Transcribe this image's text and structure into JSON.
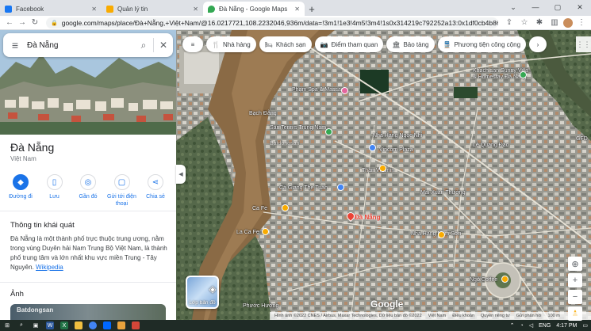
{
  "browser": {
    "tabs": [
      {
        "title": "Facebook",
        "color": "#1877f2",
        "active": false
      },
      {
        "title": "Quản lý tin",
        "color": "#f9ab00",
        "active": false
      },
      {
        "title": "Đà Nẵng - Google Maps",
        "color": "#34a853",
        "active": true
      }
    ],
    "new_tab": "+",
    "url": "google.com/maps/place/Đà+Nẵng,+Việt+Nam/@16.0217721,108.2232046,936m/data=!3m1!1e3!4m5!3m4!1s0x314219c792252a13:0x1df0cb4b86727e..."
  },
  "search": {
    "query": "Đà Nẵng"
  },
  "place": {
    "name": "Đà Nẵng",
    "country": "Việt Nam",
    "actions": [
      {
        "label": "Đường đi",
        "icon": "directions-icon",
        "glyph": "◆",
        "primary": true
      },
      {
        "label": "Lưu",
        "icon": "bookmark-icon",
        "glyph": "▯",
        "primary": false
      },
      {
        "label": "Gần đó",
        "icon": "nearby-icon",
        "glyph": "◎",
        "primary": false
      },
      {
        "label": "Gửi tới điện thoại",
        "icon": "send-to-phone-icon",
        "glyph": "▢",
        "primary": false
      },
      {
        "label": "Chia sẻ",
        "icon": "share-icon",
        "glyph": "⋖",
        "primary": false
      }
    ],
    "overview_title": "Thông tin khái quát",
    "overview_text": "Đà Nẵng là một thành phố trực thuộc trung ương, nằm trong vùng Duyên hải Nam Trung Bộ Việt Nam, là thành phố trung tâm và lớn nhất khu vực miền Trung - Tây Nguyên.",
    "overview_link": "Wikipedia",
    "photos_title": "Ảnh",
    "photo_watermark": "Batdongsan"
  },
  "map": {
    "chips": [
      {
        "label": "Nhà hàng",
        "glyph": "🍴",
        "icon": "restaurant-icon"
      },
      {
        "label": "Khách sạn",
        "glyph": "🛏",
        "icon": "hotel-icon"
      },
      {
        "label": "Điểm tham quan",
        "glyph": "📷",
        "icon": "attractions-icon"
      },
      {
        "label": "Bảo tàng",
        "glyph": "🏛",
        "icon": "museum-icon"
      },
      {
        "label": "Phương tiện công cộng",
        "glyph": "🚆",
        "icon": "transit-icon"
      }
    ],
    "labels": [
      {
        "text": "Phạm Spa & Massage",
        "cls": ""
      },
      {
        "text": "Khách sạn Sunny Villa & Homestay Đà Nẵng",
        "cls": ""
      },
      {
        "text": "Batdongsan",
        "cls": ""
      },
      {
        "text": "Vincom Plaza",
        "cls": ""
      },
      {
        "text": "Sân Tennis Trung Nam",
        "cls": ""
      },
      {
        "text": "Thân Vitamin",
        "cls": ""
      },
      {
        "text": "Nhà Hàng Ngọc Nhi",
        "cls": ""
      },
      {
        "text": "Lệ Quang Đạo",
        "cls": ""
      },
      {
        "text": "Cá Giang The Tuấn",
        "cls": ""
      },
      {
        "text": "Ca Fe",
        "cls": ""
      },
      {
        "text": "La Ca Fe",
        "cls": ""
      },
      {
        "text": "Đà Nẵng",
        "cls": "pin"
      },
      {
        "text": "Nhà Hàng Nam Sơn",
        "cls": ""
      },
      {
        "text": "Ngõ Coffee",
        "cls": ""
      },
      {
        "text": "Mai Xuân Thưởng",
        "cls": ""
      },
      {
        "text": "Bạch Đằng",
        "cls": ""
      },
      {
        "text": "Phước Hương",
        "cls": ""
      },
      {
        "text": "GFD",
        "cls": ""
      }
    ],
    "layers_label": "Lớp bản đồ",
    "logo": "Google",
    "attribution": [
      "Hình ảnh ©2022 CNES / Airbus, Maxar Technologies, Dữ liệu bản đồ ©2022",
      "Việt Nam",
      "Điều khoản",
      "Quyền riêng tư",
      "Gửi phản hồi",
      "100 m"
    ]
  },
  "taskbar": {
    "time": "4:17 PM",
    "lang": "ENG"
  }
}
